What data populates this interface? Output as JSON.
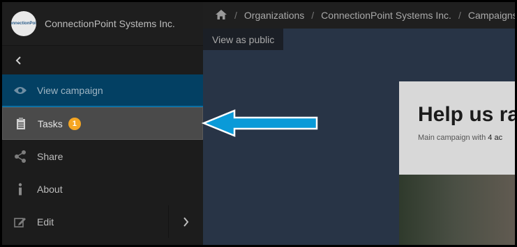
{
  "sidebar": {
    "org_name": "ConnectionPoint Systems Inc.",
    "logo_text": "connectionPoint",
    "items": [
      {
        "label": "View campaign",
        "icon": "eye-icon"
      },
      {
        "label": "Tasks",
        "icon": "clipboard-icon",
        "badge": "1"
      },
      {
        "label": "Share",
        "icon": "share-icon"
      },
      {
        "label": "About",
        "icon": "info-icon"
      },
      {
        "label": "Edit",
        "icon": "edit-icon"
      }
    ]
  },
  "breadcrumb": {
    "items": [
      "Organizations",
      "ConnectionPoint Systems Inc.",
      "Campaigns"
    ]
  },
  "view_public_label": "View as public",
  "campaign": {
    "title": "Help us ra",
    "subtitle_prefix": "Main campaign with ",
    "subtitle_bold": "4 ac"
  },
  "colors": {
    "accent": "#0a9ad8",
    "badge": "#f5a623",
    "active_bg": "#034063"
  }
}
